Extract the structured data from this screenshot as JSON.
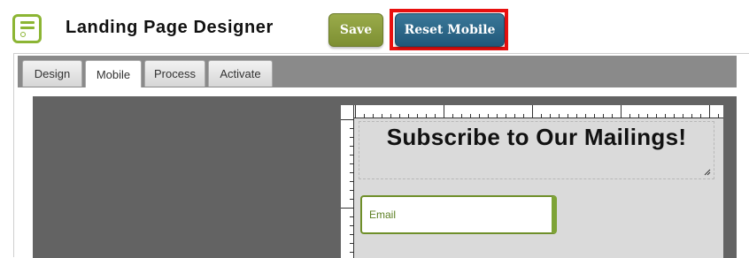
{
  "header": {
    "app_icon": "menu-list-icon",
    "title": "Landing Page Designer",
    "save_label": "Save",
    "reset_label": "Reset Mobile"
  },
  "tabs": [
    {
      "label": "Design",
      "active": false
    },
    {
      "label": "Mobile",
      "active": true
    },
    {
      "label": "Process",
      "active": false
    },
    {
      "label": "Activate",
      "active": false
    }
  ],
  "page": {
    "headline": "Subscribe to Our Mailings!",
    "email_placeholder": "Email"
  },
  "colors": {
    "accent_green": "#8cb534",
    "save_button": "#8a9c3f",
    "reset_button": "#2e6a8c",
    "highlight": "#e8100f",
    "canvas": "#636363",
    "page_background": "#dadada"
  }
}
